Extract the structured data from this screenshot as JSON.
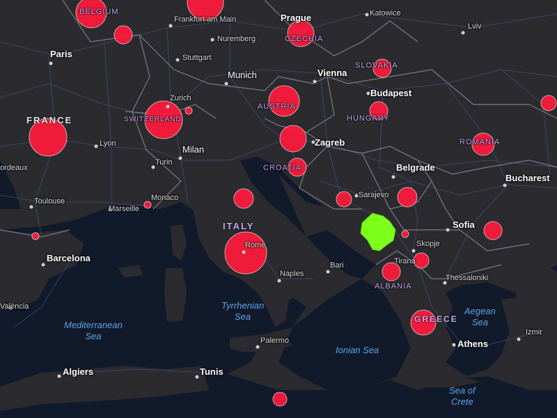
{
  "map": {
    "countries": {
      "belgium": "BELGIUM",
      "czechia": "CZECHIA",
      "slovakia": "SLOVAKIA",
      "france": "FRANCE",
      "switzerland": "SWITZERLAND",
      "austria": "AUSTRIA",
      "hungary": "HUNGARY",
      "romania": "ROMANIA",
      "croatia": "CROATIA",
      "italy": "ITALY",
      "albania": "ALBANIA",
      "greece": "GREECE"
    },
    "cities": {
      "frankfurt": "Frankfurt am Main",
      "prague": "Prague",
      "katowice": "Katowice",
      "lviv": "Lviv",
      "paris": "Paris",
      "nuremberg": "Nuremberg",
      "stuttgart": "Stuttgart",
      "munich": "Munich",
      "vienna": "Vienna",
      "budapest": "Budapest",
      "zurich": "Zurich",
      "lyon": "Lyon",
      "milan": "Milan",
      "zagreb": "Zagreb",
      "bordeaux": "ordeaux",
      "turin": "Turin",
      "belgrade": "Belgrade",
      "bucharest": "Bucharest",
      "monaco": "Monaco",
      "toulouse": "Toulouse",
      "marseille": "Marseille",
      "sarajevo": "Sarajevo",
      "sofia": "Sofia",
      "skopje": "Skopje",
      "rome": "Rome",
      "barcelona": "Barcelona",
      "bari": "Bari",
      "naples": "Naples",
      "tirana": "Tirana",
      "thessaloniki": "Thessaloniki",
      "valencia": "València",
      "izmir": "Izmir",
      "athens": "Athens",
      "palermo": "Palermo",
      "algiers": "Algiers",
      "tunis": "Tunis"
    },
    "seas": {
      "tyrrhenian": "Tyrrhenian\nSea",
      "mediterranean": "Mediterranean\nSea",
      "ionian": "Ionian Sea",
      "aegean": "Aegean\nSea",
      "crete": "Sea of\nCrete"
    },
    "colors": {
      "ocean": "#111a2a",
      "land": "#2b2b2f",
      "border": "#6d6d7a",
      "road": "#3a4e78",
      "marker": "#ff1a3c",
      "highlight": "#7cff1a"
    },
    "highlighted_country": "Montenegro"
  }
}
